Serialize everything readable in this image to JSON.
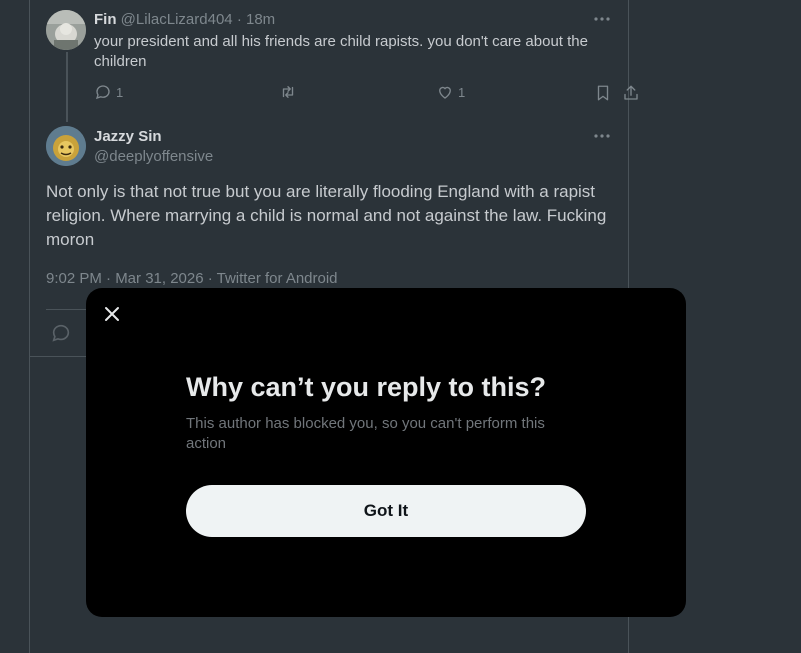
{
  "reply_tweet": {
    "display_name": "Fin",
    "handle": "@LilacLizard404",
    "time": "· 18m",
    "text": "your president and all his friends are child rapists. you don't care about the children",
    "reply_count": "1",
    "like_count": "1"
  },
  "main_tweet": {
    "display_name": "Jazzy Sin",
    "handle": "@deeplyoffensive",
    "text": "Not only is that not true but you are literally flooding England with a rapist religion. Where marrying a child is normal and not against the law. Fucking moron",
    "timestamp": "9:02 PM · Mar 31, 2026 · Twitter for Android"
  },
  "modal": {
    "title": "Why can’t you reply to this?",
    "body": "This author has blocked you, so you can't perform this action",
    "button_label": "Got It"
  }
}
